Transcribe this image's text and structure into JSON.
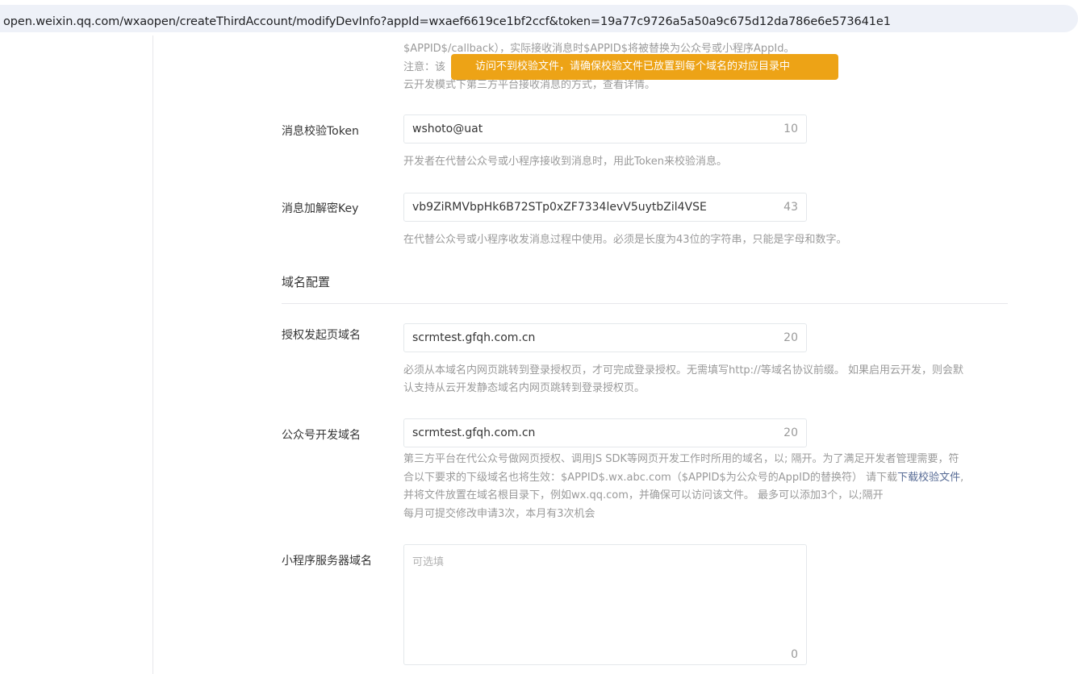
{
  "browser": {
    "url": "open.weixin.qq.com/wxaopen/createThirdAccount/modifyDevInfo?appId=wxaef6619ce1bf2ccf&token=19a77c9726a5a50a9c675d12da786e6e573641e1"
  },
  "top_notes": {
    "line1": "$APPID$/callback），实际接收消息时$APPID$将被替换为公众号或小程序AppId。",
    "line2": "注意：该",
    "line3": "云开发模式下第三方平台接收消息的方式，查看详情。"
  },
  "toast": {
    "text": "访问不到校验文件，请确保校验文件已放置到每个域名的对应目录中"
  },
  "fields": {
    "token": {
      "label": "消息校验Token",
      "value": "wshoto@uat",
      "count": "10",
      "help": "开发者在代替公众号或小程序接收到消息时，用此Token来校验消息。"
    },
    "aes_key": {
      "label": "消息加解密Key",
      "value": "vb9ZiRMVbpHk6B72STp0xZF7334levV5uytbZil4VSE",
      "count": "43",
      "help": "在代替公众号或小程序收发消息过程中使用。必须是长度为43位的字符串，只能是字母和数字。"
    },
    "auth_domain": {
      "label": "授权发起页域名",
      "value": "scrmtest.gfqh.com.cn",
      "count": "20",
      "help_line1": "必须从本域名内网页跳转到登录授权页，才可完成登录授权。无需填写http://等域名协议前缀。 如果启用云开发，则会默",
      "help_line2": "认支持从云开发静态域名内网页跳转到登录授权页。"
    },
    "mp_domain": {
      "label": "公众号开发域名",
      "value": "scrmtest.gfqh.com.cn",
      "count": "20",
      "help_line1": "第三方平台在代公众号做网页授权、调用JS SDK等网页开发工作时所用的域名，以; 隔开。为了满足开发者管理需要，符",
      "help_line2": "合以下要求的下级域名也将生效：$APPID$.wx.abc.com（$APPID$为公众号的AppID的替换符） 请下载",
      "help_link": "下载校验文件",
      "help_line2_tail": ",",
      "help_line3": "并将文件放置在域名根目录下，例如wx.qq.com，并确保可以访问该文件。 最多可以添加3个，以;隔开",
      "help_line4": "每月可提交修改申请3次，本月有3次机会"
    },
    "miniprogram_domain": {
      "label": "小程序服务器域名",
      "placeholder": "可选填",
      "count": "0"
    }
  },
  "section": {
    "title": "域名配置"
  }
}
